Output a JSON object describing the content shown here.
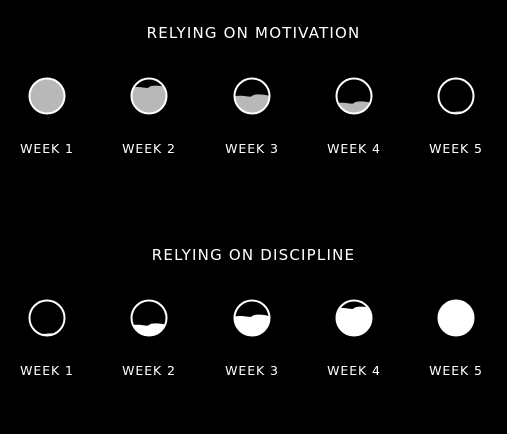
{
  "colors": {
    "background": "#000000",
    "foreground": "#ffffff",
    "fill_motivation": "#b8b8b8",
    "fill_discipline": "#ffffff"
  },
  "sections": [
    {
      "title": "RELYING ON MOTIVATION",
      "fill_color": "#b8b8b8",
      "weeks": [
        {
          "label": "WEEK 1",
          "fill_level": 1.0
        },
        {
          "label": "WEEK 2",
          "fill_level": 0.75
        },
        {
          "label": "WEEK 3",
          "fill_level": 0.5
        },
        {
          "label": "WEEK 4",
          "fill_level": 0.3
        },
        {
          "label": "WEEK 5",
          "fill_level": 0.05
        }
      ]
    },
    {
      "title": "RELYING ON DISCIPLINE",
      "fill_color": "#ffffff",
      "weeks": [
        {
          "label": "WEEK 1",
          "fill_level": 0.05
        },
        {
          "label": "WEEK 2",
          "fill_level": 0.3
        },
        {
          "label": "WEEK 3",
          "fill_level": 0.55
        },
        {
          "label": "WEEK 4",
          "fill_level": 0.78
        },
        {
          "label": "WEEK 5",
          "fill_level": 1.0
        }
      ]
    }
  ]
}
